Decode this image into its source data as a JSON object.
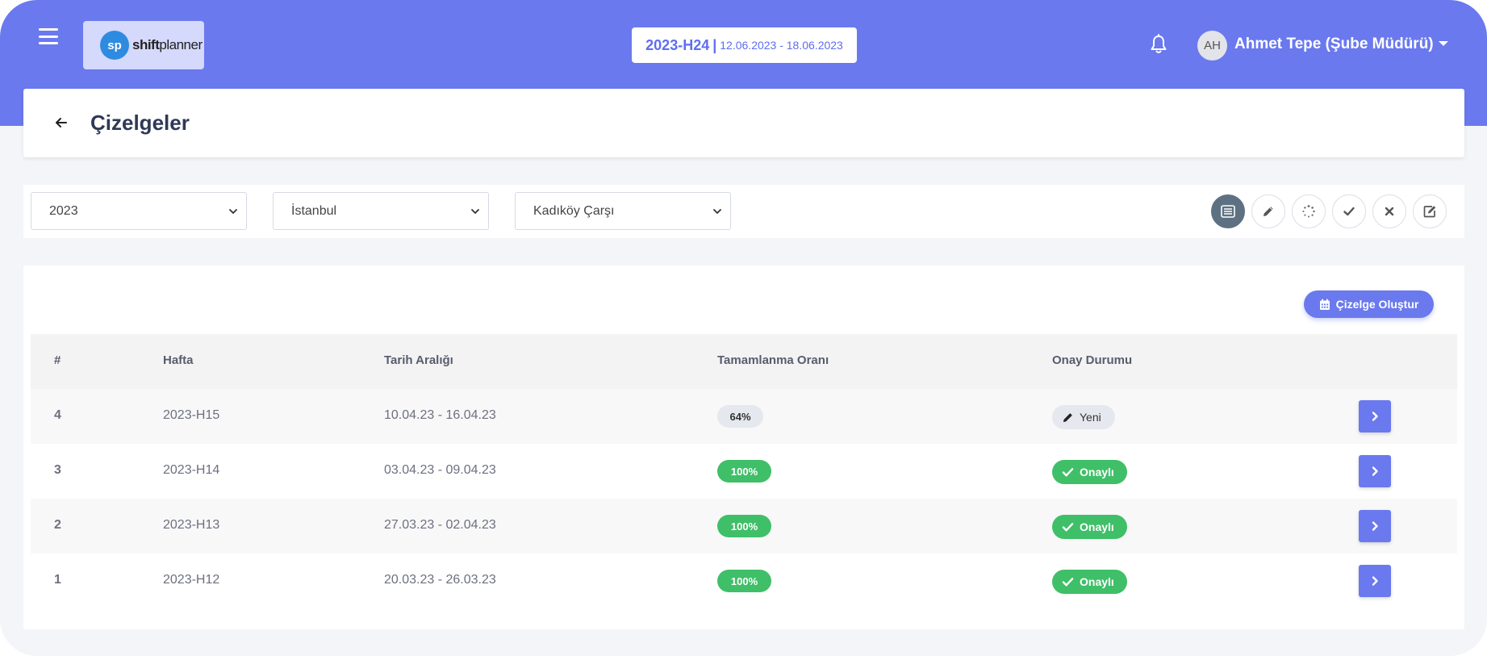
{
  "app": {
    "logo_mark": "sp",
    "logo_bold": "shift",
    "logo_rest": "planner",
    "icons": {
      "menu": "hamburger-icon",
      "notifications": "bell-icon",
      "user_menu": "chevron-down-icon"
    }
  },
  "header": {
    "week_code": "2023-H24",
    "week_separator": "|",
    "week_range": "12.06.2023 - 18.06.2023",
    "user_initials": "AH",
    "user_name": "Ahmet Tepe (Şube Müdürü)"
  },
  "page": {
    "title": "Çizelgeler"
  },
  "filters": {
    "year": "2023",
    "city": "İstanbul",
    "branch": "Kadıköy Çarşı",
    "view_buttons": [
      {
        "name": "list-view-icon",
        "active": true
      },
      {
        "name": "pencil-icon",
        "active": false
      },
      {
        "name": "loading-spinner-icon",
        "active": false
      },
      {
        "name": "check-icon",
        "active": false
      },
      {
        "name": "close-icon",
        "active": false
      },
      {
        "name": "edit-square-icon",
        "active": false
      }
    ]
  },
  "table": {
    "create_button": "Çizelge Oluştur",
    "columns": [
      "#",
      "Hafta",
      "Tarih Aralığı",
      "Tamamlanma Oranı",
      "Onay Durumu"
    ],
    "rows": [
      {
        "num": "4",
        "week": "2023-H15",
        "range": "10.04.23 - 16.04.23",
        "completion": "64%",
        "completion_status": "partial",
        "status": "Yeni",
        "status_type": "new"
      },
      {
        "num": "3",
        "week": "2023-H14",
        "range": "03.04.23 - 09.04.23",
        "completion": "100%",
        "completion_status": "full",
        "status": "Onaylı",
        "status_type": "approved"
      },
      {
        "num": "2",
        "week": "2023-H13",
        "range": "27.03.23 - 02.04.23",
        "completion": "100%",
        "completion_status": "full",
        "status": "Onaylı",
        "status_type": "approved"
      },
      {
        "num": "1",
        "week": "2023-H12",
        "range": "20.03.23 - 26.03.23",
        "completion": "100%",
        "completion_status": "full",
        "status": "Onaylı",
        "status_type": "approved"
      }
    ]
  },
  "colors": {
    "primary": "#6a79ee",
    "success": "#3fbf68",
    "active_view": "#5d7182"
  }
}
